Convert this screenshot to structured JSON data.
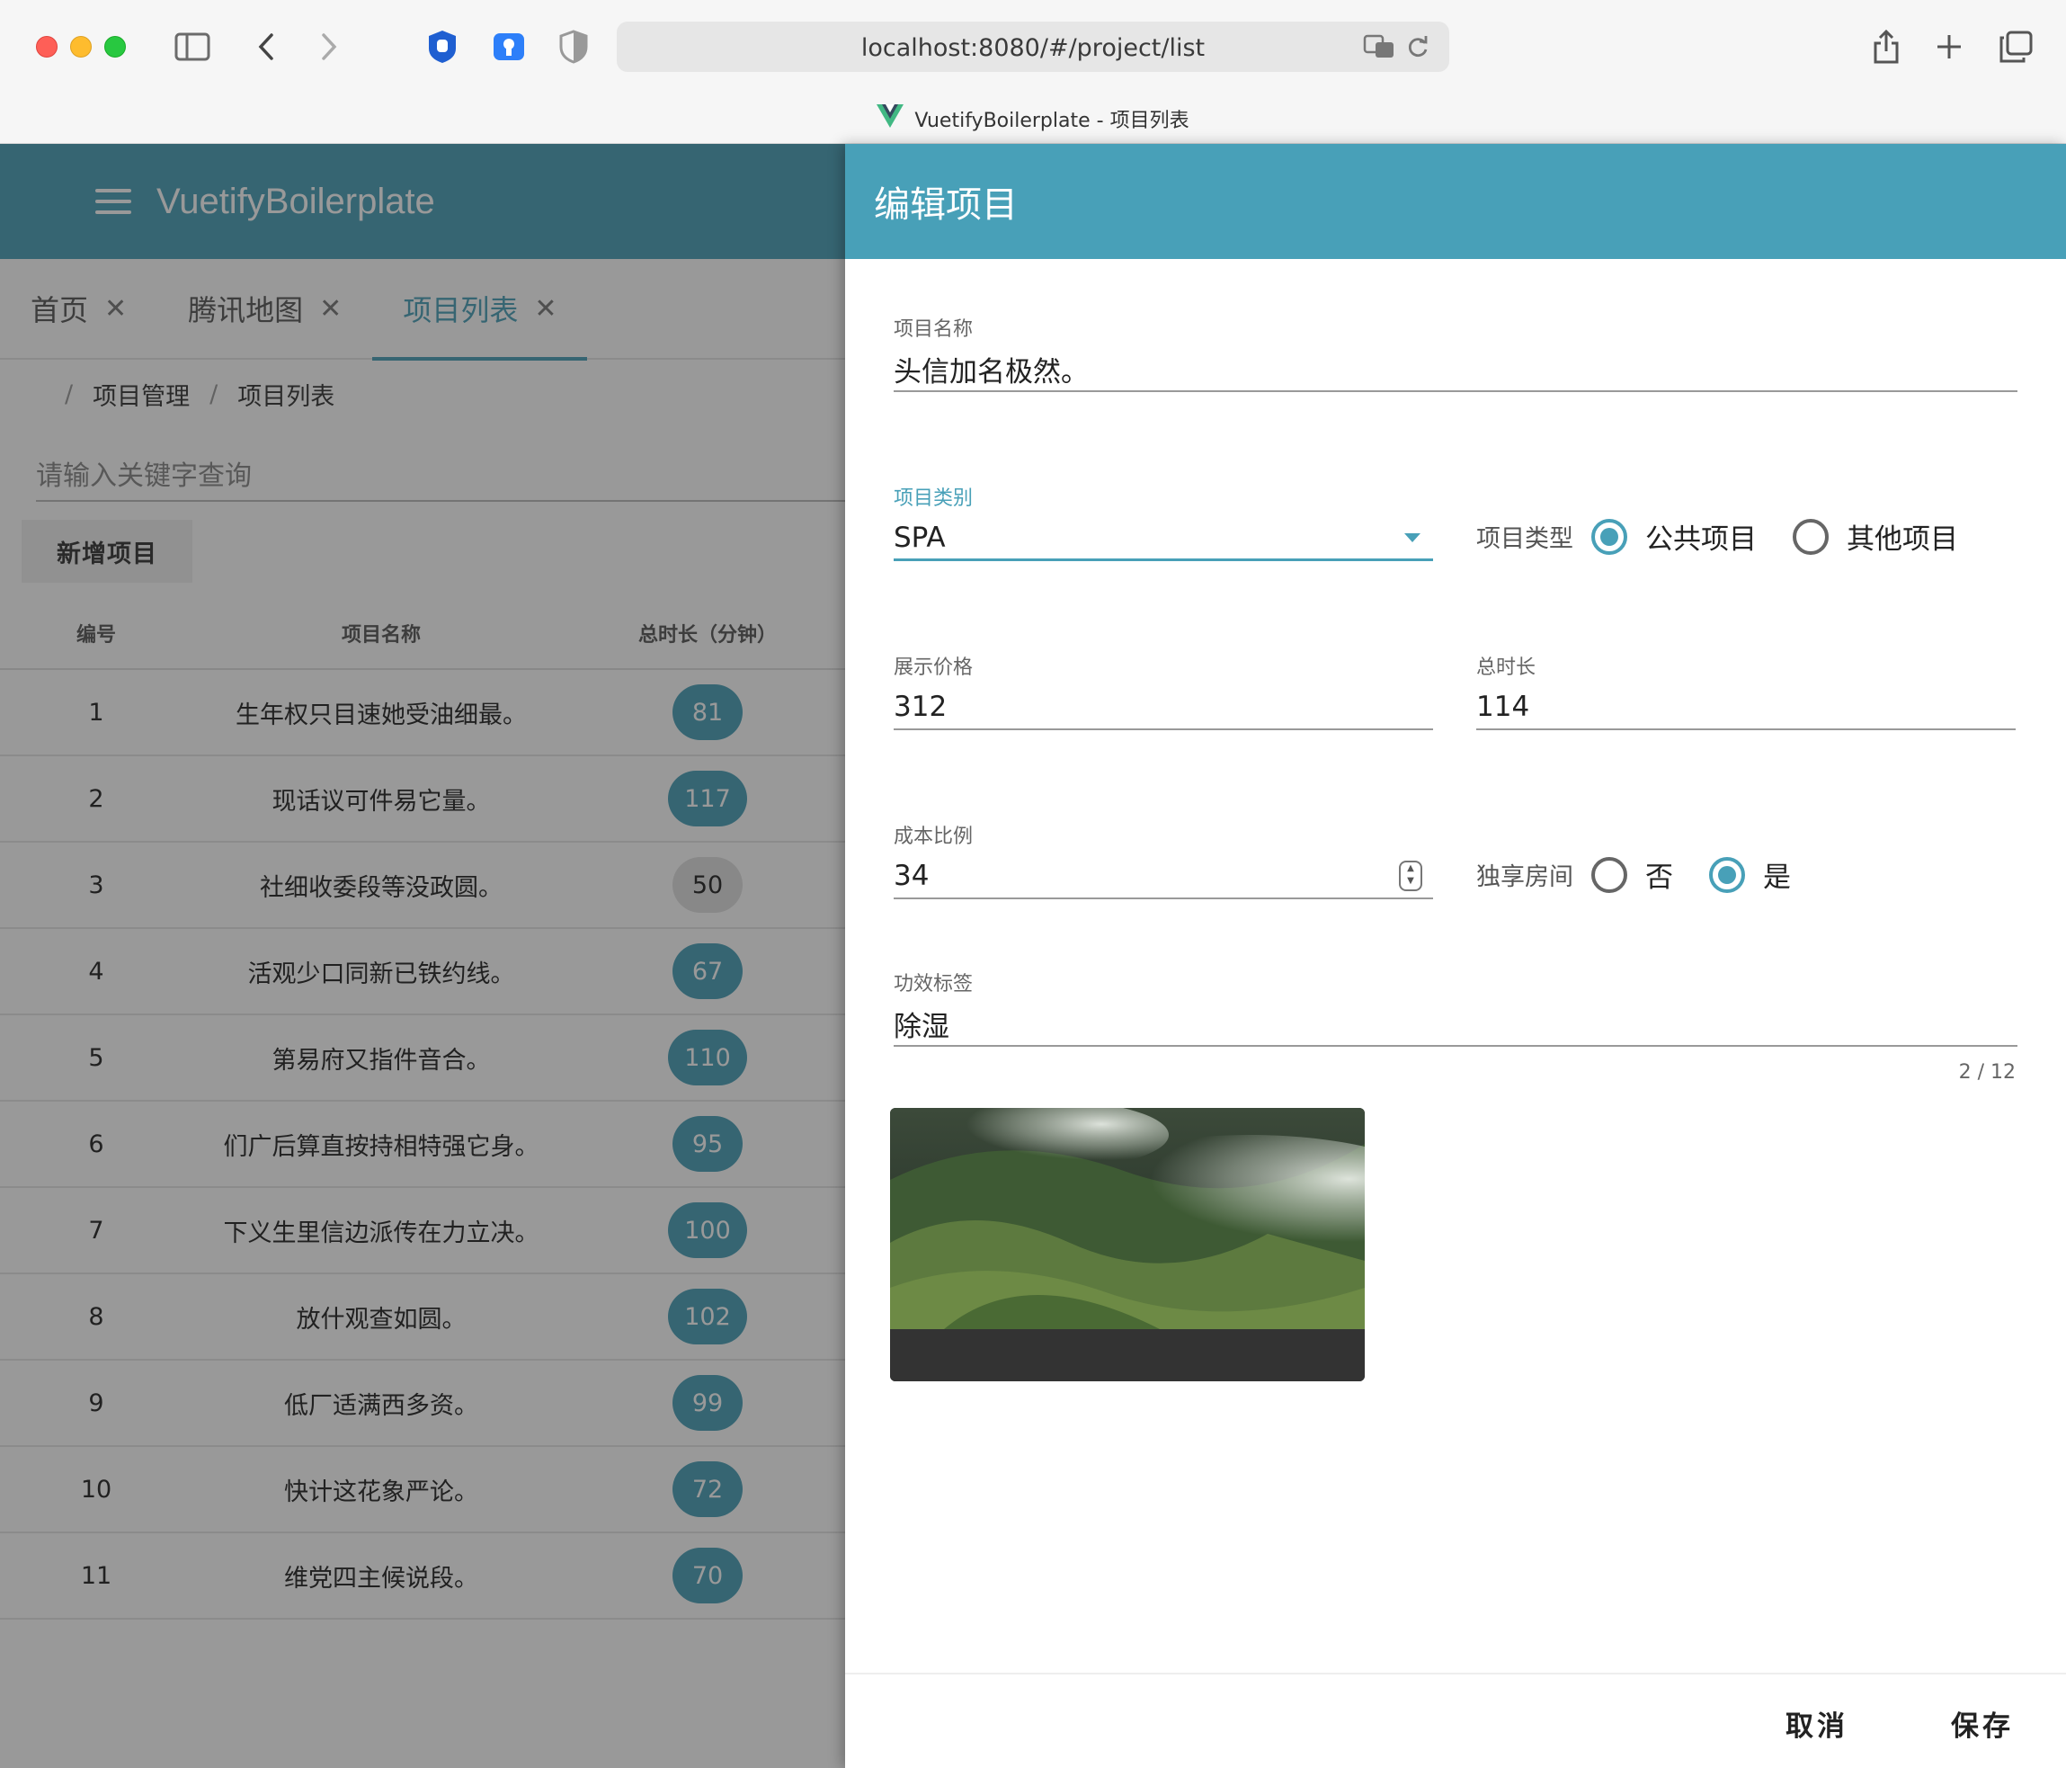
{
  "browser": {
    "url": "localhost:8080/#/project/list",
    "tab_title": "VuetifyBoilerplate - 项目列表"
  },
  "app": {
    "brand": "VuetifyBoilerplate",
    "tabs": [
      {
        "label": "首页",
        "active": false
      },
      {
        "label": "腾讯地图",
        "active": false
      },
      {
        "label": "项目列表",
        "active": true
      }
    ],
    "breadcrumb": [
      "项目管理",
      "项目列表"
    ],
    "search_placeholder": "请输入关键字查询",
    "add_button": "新增项目",
    "table": {
      "headers": [
        "编号",
        "项目名称",
        "总时长（分钟）"
      ],
      "rows": [
        {
          "no": "1",
          "name": "生年权只目速她受油细最。",
          "duration": "81"
        },
        {
          "no": "2",
          "name": "现话议可件易它量。",
          "duration": "117"
        },
        {
          "no": "3",
          "name": "社细收委段等没政圆。",
          "duration": "50"
        },
        {
          "no": "4",
          "name": "活观少口同新已铁约线。",
          "duration": "67"
        },
        {
          "no": "5",
          "name": "第易府又指件音合。",
          "duration": "110"
        },
        {
          "no": "6",
          "name": "们广后算直按持相特强它身。",
          "duration": "95"
        },
        {
          "no": "7",
          "name": "下义生里信边派传在力立决。",
          "duration": "100"
        },
        {
          "no": "8",
          "name": "放什观查如圆。",
          "duration": "102"
        },
        {
          "no": "9",
          "name": "低厂适满西多资。",
          "duration": "99"
        },
        {
          "no": "10",
          "name": "快计这花象严论。",
          "duration": "72"
        },
        {
          "no": "11",
          "name": "维党四主候说段。",
          "duration": "70"
        }
      ]
    }
  },
  "drawer": {
    "title": "编辑项目",
    "name_label": "项目名称",
    "name_value": "头信加名极然。",
    "category_label": "项目类别",
    "category_value": "SPA",
    "type_label": "项目类型",
    "type_options": [
      "公共项目",
      "其他项目"
    ],
    "type_selected": "公共项目",
    "price_label": "展示价格",
    "price_value": "312",
    "total_label": "总时长",
    "total_value": "114",
    "cost_label": "成本比例",
    "cost_value": "34",
    "exclusive_label": "独享房间",
    "exclusive_options": [
      "否",
      "是"
    ],
    "exclusive_selected": "是",
    "tag_label": "功效标签",
    "tag_value": "除湿",
    "tag_counter": "2 / 12",
    "cancel": "取消",
    "save": "保存"
  },
  "colors": {
    "primary": "#48a0b8",
    "chip_grey": "#e0e0e0"
  }
}
